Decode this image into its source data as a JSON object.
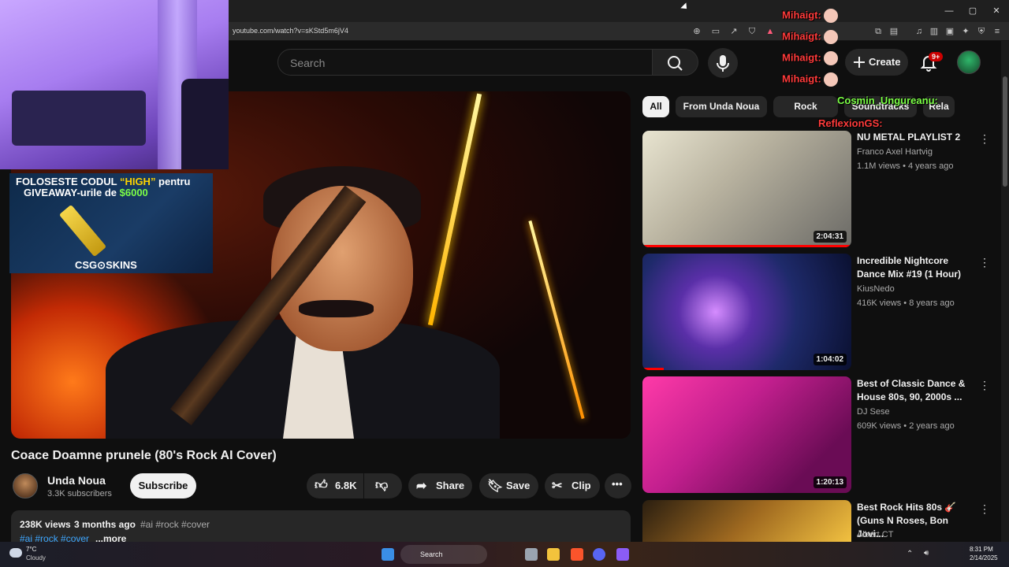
{
  "browser": {
    "url": "youtube.com/watch?v=sKStd5m6jV4"
  },
  "header": {
    "search_placeholder": "Search",
    "create_label": "Create",
    "notifications_count": "9+"
  },
  "overlay": {
    "promo_line1_a": "FOLOSESTE CODUL ",
    "promo_line1_b": "“HIGH”",
    "promo_line1_c": " pentru",
    "promo_line2_a": "GIVEAWAY-urile de ",
    "promo_line2_b": "$6000",
    "promo_logo": "CSG⊙SKINS",
    "chat": [
      {
        "user": "Mihaigt:"
      },
      {
        "user": "Mihaigt:"
      },
      {
        "user": "Mihaigt:"
      },
      {
        "user": "Mihaigt:"
      }
    ],
    "chat_cosmin": "Cosmin_Ungureanu:",
    "chat_reflexion": "ReflexionGS:"
  },
  "video": {
    "title": "Coace Doamne prunele (80's Rock AI Cover)",
    "channel": "Unda Noua",
    "subscribers": "3.3K subscribers",
    "subscribe_label": "Subscribe",
    "likes": "6.8K",
    "share_label": "Share",
    "save_label": "Save",
    "clip_label": "Clip",
    "views": "238K views",
    "date": "3 months ago",
    "tags": "#ai #rock #cover",
    "tags2": "#ai #rock #cover",
    "more_label": "...more"
  },
  "chips": [
    "All",
    "From Unda Noua",
    "Rock",
    "Soundtracks",
    "Rela"
  ],
  "recommendations": [
    {
      "title": "NU METAL PLAYLIST 2",
      "channel": "Franco Axel Hartvig",
      "meta": "1.1M views • 4 years ago",
      "duration": "2:04:31"
    },
    {
      "title": "Incredible Nightcore Dance Mix #19 (1 Hour)",
      "channel": "KiusNedo",
      "meta": "416K views • 8 years ago",
      "duration": "1:04:02"
    },
    {
      "title": "Best of Classic Dance & House 80s, 90, 2000s ...",
      "channel": "DJ Sese",
      "meta": "609K views • 2 years ago",
      "duration": "1:20:13"
    },
    {
      "title": "Best Rock Hits 80s 🎸 (Guns N Roses, Bon Jovi...",
      "channel": "Albert CT",
      "meta": "",
      "duration": ""
    }
  ],
  "taskbar": {
    "temp": "7°C",
    "weather": "Cloudy",
    "search": "Search",
    "time": "8:31 PM",
    "date": "2/14/2025"
  }
}
